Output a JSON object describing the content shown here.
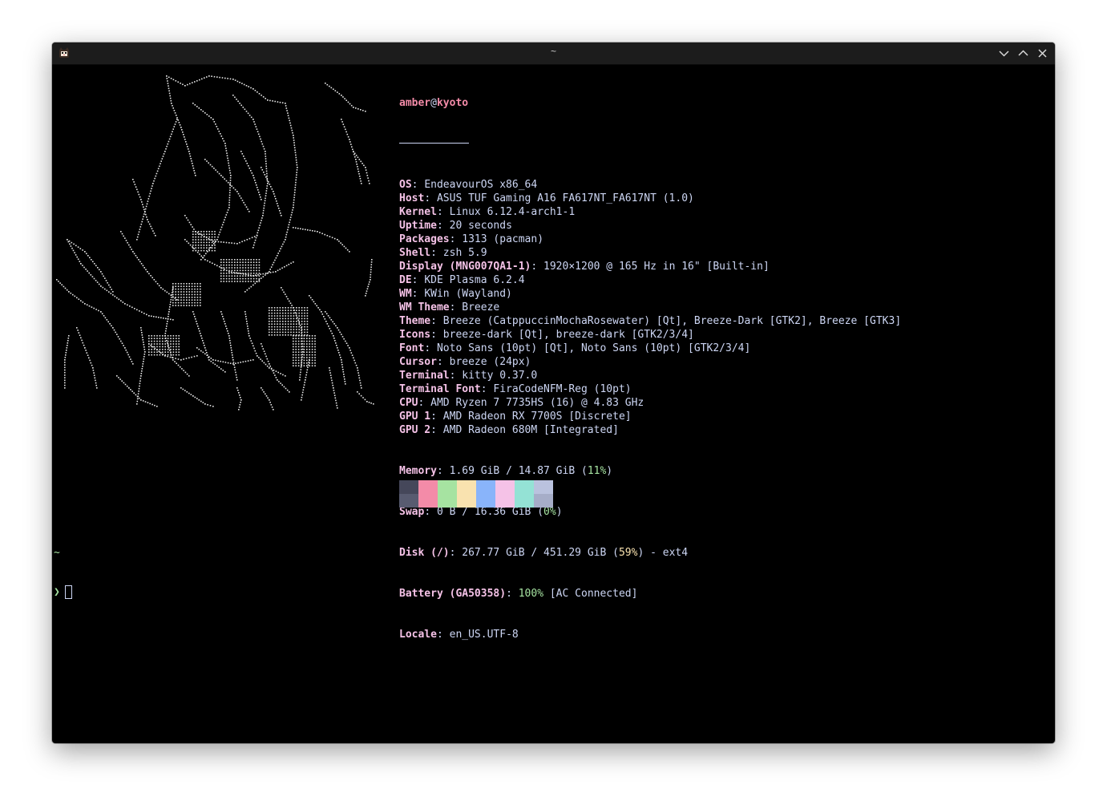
{
  "window": {
    "title": "~",
    "app_icon": "kitty-cat-icon",
    "controls": [
      "minimize-chevron-down-icon",
      "maximize-chevron-up-icon",
      "close-x-icon"
    ]
  },
  "fetch": {
    "user": "amber",
    "at": "@",
    "host": "kyoto",
    "rows": [
      {
        "key": "OS",
        "value": "EndeavourOS x86_64"
      },
      {
        "key": "Host",
        "value": "ASUS TUF Gaming A16 FA617NT_FA617NT (1.0)"
      },
      {
        "key": "Kernel",
        "value": "Linux 6.12.4-arch1-1"
      },
      {
        "key": "Uptime",
        "value": "20 seconds"
      },
      {
        "key": "Packages",
        "value": "1313 (pacman)"
      },
      {
        "key": "Shell",
        "value": "zsh 5.9"
      },
      {
        "key": "Display (MNG007QA1-1)",
        "value": "1920×1200 @ 165 Hz in 16\" [Built-in]"
      },
      {
        "key": "DE",
        "value": "KDE Plasma 6.2.4"
      },
      {
        "key": "WM",
        "value": "KWin (Wayland)"
      },
      {
        "key": "WM Theme",
        "value": "Breeze"
      },
      {
        "key": "Theme",
        "value": "Breeze (CatppuccinMochaRosewater) [Qt], Breeze-Dark [GTK2], Breeze [GTK3]"
      },
      {
        "key": "Icons",
        "value": "breeze-dark [Qt], breeze-dark [GTK2/3/4]"
      },
      {
        "key": "Font",
        "value": "Noto Sans (10pt) [Qt], Noto Sans (10pt) [GTK2/3/4]"
      },
      {
        "key": "Cursor",
        "value": "breeze (24px)"
      },
      {
        "key": "Terminal",
        "value": "kitty 0.37.0"
      },
      {
        "key": "Terminal Font",
        "value": "FiraCodeNFM-Reg (10pt)"
      },
      {
        "key": "CPU",
        "value": "AMD Ryzen 7 7735HS (16) @ 4.83 GHz"
      },
      {
        "key": "GPU 1",
        "value": "AMD Radeon RX 7700S [Discrete]"
      },
      {
        "key": "GPU 2",
        "value": "AMD Radeon 680M [Integrated]"
      }
    ],
    "memory": {
      "key": "Memory",
      "pre": "1.69 GiB / 14.87 GiB (",
      "pct": "11%",
      "post": ")"
    },
    "swap": {
      "key": "Swap",
      "pre": "0 B / 16.36 GiB (",
      "pct": "0%",
      "post": ")"
    },
    "disk": {
      "key": "Disk (/)",
      "pre": "267.77 GiB / 451.29 GiB (",
      "pct": "59%",
      "post": ") - ext4"
    },
    "battery": {
      "key": "Battery (GA50358)",
      "pct": "100%",
      "post": " [AC Connected]"
    },
    "locale": {
      "key": "Locale",
      "value": "en_US.UTF-8"
    }
  },
  "palette": {
    "top": [
      "#45475a",
      "#f38ba8",
      "#a6e3a1",
      "#f9e2af",
      "#89b4fa",
      "#f5c2e7",
      "#94e2d5",
      "#bac2de"
    ],
    "bottom": [
      "#585b70",
      "#f38ba8",
      "#a6e3a1",
      "#f9e2af",
      "#89b4fa",
      "#f5c2e7",
      "#94e2d5",
      "#a6adc8"
    ]
  },
  "prompt": {
    "dir": "~",
    "symbol": "❯"
  },
  "colors": {
    "key": "#f5c2e7",
    "user": "#f38ba8",
    "text": "#cdd6f4",
    "green": "#a6e3a1",
    "yellow": "#f9e2af",
    "background": "#000000"
  }
}
